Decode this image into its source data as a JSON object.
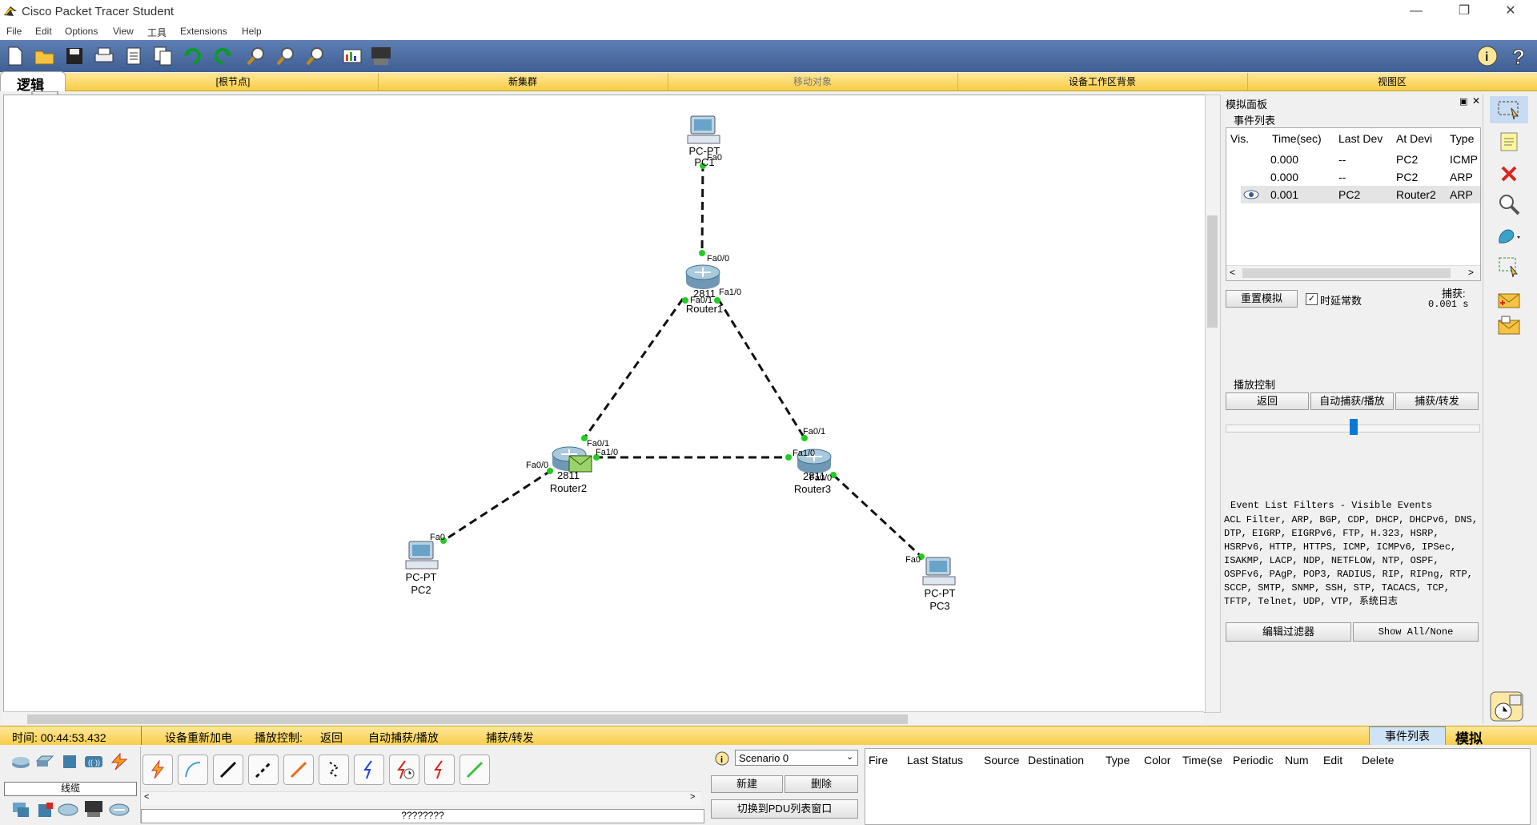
{
  "window": {
    "title": "Cisco Packet Tracer Student",
    "minimize": "—",
    "restore": "❐",
    "close": "✕"
  },
  "menu": [
    "File",
    "Edit",
    "Options",
    "View",
    "工具",
    "Extensions",
    "Help"
  ],
  "nav": {
    "logic_tab": "逻辑",
    "root": "[根节点]",
    "new_cluster": "新集群",
    "move_object": "移动对象",
    "workspace_bg": "设备工作区背景",
    "viewport": "视图区"
  },
  "devices": {
    "pc1": {
      "type": "PC-PT",
      "name": "PC1",
      "port": "Fa0"
    },
    "pc2": {
      "type": "PC-PT",
      "name": "PC2",
      "port": "Fa0"
    },
    "pc3": {
      "type": "PC-PT",
      "name": "PC3",
      "port": "Fa0"
    },
    "router1": {
      "model": "2811",
      "name": "Router1",
      "ports": [
        "Fa0/0",
        "Fa0/1",
        "Fa1/0"
      ]
    },
    "router2": {
      "model": "2811",
      "name": "Router2",
      "ports": [
        "Fa0/1",
        "Fa1/0",
        "Fa0/0"
      ]
    },
    "router3": {
      "model": "2811",
      "name": "Router3",
      "ports": [
        "Fa0/1",
        "Fa1/0",
        "Fa0/0"
      ]
    }
  },
  "sim_panel": {
    "title": "模拟面板",
    "event_list_label": "事件列表",
    "columns": [
      "Vis.",
      "Time(sec)",
      "Last Dev",
      "At Devi",
      "Type"
    ],
    "events": [
      {
        "time": "0.000",
        "last": "--",
        "at": "PC2",
        "type": "ICMP"
      },
      {
        "time": "0.000",
        "last": "--",
        "at": "PC2",
        "type": "ARP"
      },
      {
        "time": "0.001",
        "last": "PC2",
        "at": "Router2",
        "type": "ARP"
      }
    ],
    "reset": "重置模拟",
    "delay_checkbox": "时延常数",
    "capture_label": "捕获:",
    "capture_value": "0.001 s",
    "playback_label": "播放控制",
    "back": "返回",
    "auto_capture": "自动捕获/播放",
    "capture_forward": "捕获/转发",
    "filters_title": "Event List Filters - Visible Events",
    "filters_text": "ACL Filter, ARP, BGP, CDP, DHCP, DHCPv6, DNS, DTP, EIGRP, EIGRPv6, FTP, H.323, HSRP, HSRPv6, HTTP, HTTPS, ICMP, ICMPv6, IPSec, ISAKMP, LACP, NDP, NETFLOW, NTP, OSPF, OSPFv6, PAgP, POP3, RADIUS, RIP, RIPng, RTP, SCCP, SMTP, SNMP, SSH, STP, TACACS, TCP, TFTP, Telnet, UDP, VTP, 系统日志",
    "edit_filters": "编辑过滤器",
    "show_all": "Show All/None"
  },
  "status": {
    "time": "时间: 00:44:53.432",
    "power_cycle": "设备重新加电",
    "playback": "播放控制:",
    "back": "返回",
    "auto": "自动捕获/播放",
    "capture": "捕获/转发",
    "event_list_tab": "事件列表",
    "sim_tab": "模拟"
  },
  "bottom": {
    "category": "线缆",
    "cable_name": "????????",
    "scenario": "Scenario 0",
    "new": "新建",
    "delete": "删除",
    "toggle_pdu": "切换到PDU列表窗口",
    "pdu_columns": [
      "Fire",
      "Last Status",
      "Source",
      "Destination",
      "Type",
      "Color",
      "Time(se",
      "Periodic",
      "Num",
      "Edit",
      "Delete"
    ]
  },
  "colors": {
    "toolbar": "#4a6ca3",
    "yellow_bar": "#f7cd45",
    "link_dot": "#22cc22"
  }
}
